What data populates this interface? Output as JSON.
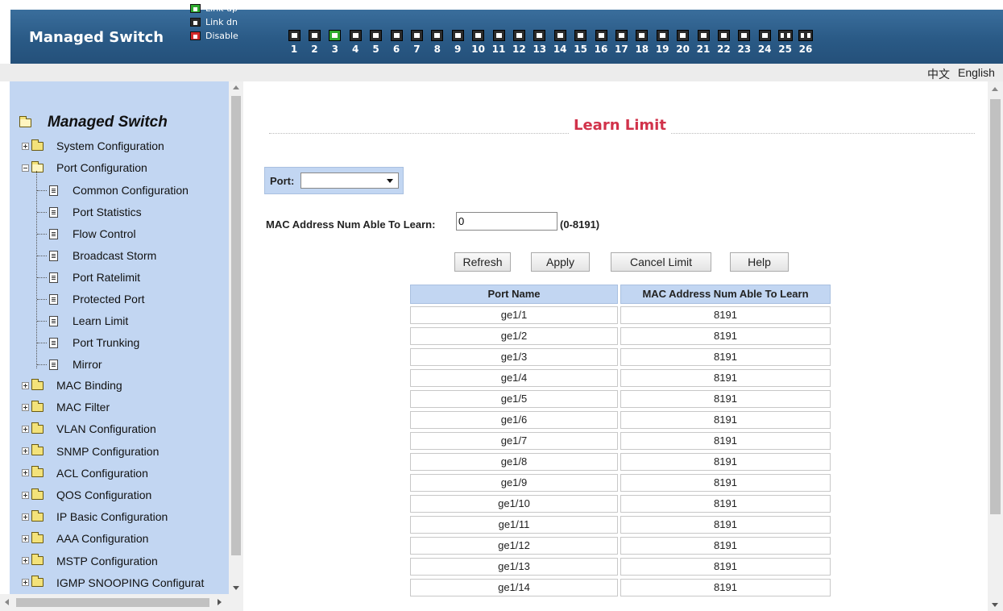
{
  "header": {
    "brand": "Managed Switch",
    "legend": [
      {
        "label": "Link up",
        "color": "#2eaa2e"
      },
      {
        "label": "Link dn",
        "color": "#2b2b2b"
      },
      {
        "label": "Disable",
        "color": "#d42a2a"
      }
    ],
    "ports": [
      "1",
      "2",
      "3",
      "4",
      "5",
      "6",
      "7",
      "8",
      "9",
      "10",
      "11",
      "12",
      "13",
      "14",
      "15",
      "16",
      "17",
      "18",
      "19",
      "20",
      "21",
      "22",
      "23",
      "24",
      "25",
      "26"
    ],
    "ports_link_up": [
      "3"
    ]
  },
  "lang": {
    "chinese": "中文",
    "english": "English"
  },
  "sidebar": {
    "root": "Managed Switch",
    "system": "System Configuration",
    "port_config": "Port Configuration",
    "port_children": [
      "Common Configuration",
      "Port Statistics",
      "Flow Control",
      "Broadcast Storm",
      "Port Ratelimit",
      "Protected Port",
      "Learn Limit",
      "Port Trunking",
      "Mirror"
    ],
    "folders": [
      "MAC Binding",
      "MAC Filter",
      "VLAN Configuration",
      "SNMP Configuration",
      "ACL Configuration",
      "QOS Configuration",
      "IP Basic Configuration",
      "AAA Configuration",
      "MSTP Configuration",
      "IGMP SNOOPING Configurat"
    ]
  },
  "main": {
    "title": "Learn Limit",
    "port_label": "Port:",
    "port_value": "",
    "mac_label": "MAC Address Num Able To Learn:",
    "mac_value": "0",
    "mac_range": "(0-8191)",
    "buttons": {
      "refresh": "Refresh",
      "apply": "Apply",
      "cancel": "Cancel Limit",
      "help": "Help"
    },
    "table": {
      "headers": [
        "Port Name",
        "MAC Address Num Able To Learn"
      ],
      "rows": [
        [
          "ge1/1",
          "8191"
        ],
        [
          "ge1/2",
          "8191"
        ],
        [
          "ge1/3",
          "8191"
        ],
        [
          "ge1/4",
          "8191"
        ],
        [
          "ge1/5",
          "8191"
        ],
        [
          "ge1/6",
          "8191"
        ],
        [
          "ge1/7",
          "8191"
        ],
        [
          "ge1/8",
          "8191"
        ],
        [
          "ge1/9",
          "8191"
        ],
        [
          "ge1/10",
          "8191"
        ],
        [
          "ge1/11",
          "8191"
        ],
        [
          "ge1/12",
          "8191"
        ],
        [
          "ge1/13",
          "8191"
        ],
        [
          "ge1/14",
          "8191"
        ]
      ]
    }
  }
}
